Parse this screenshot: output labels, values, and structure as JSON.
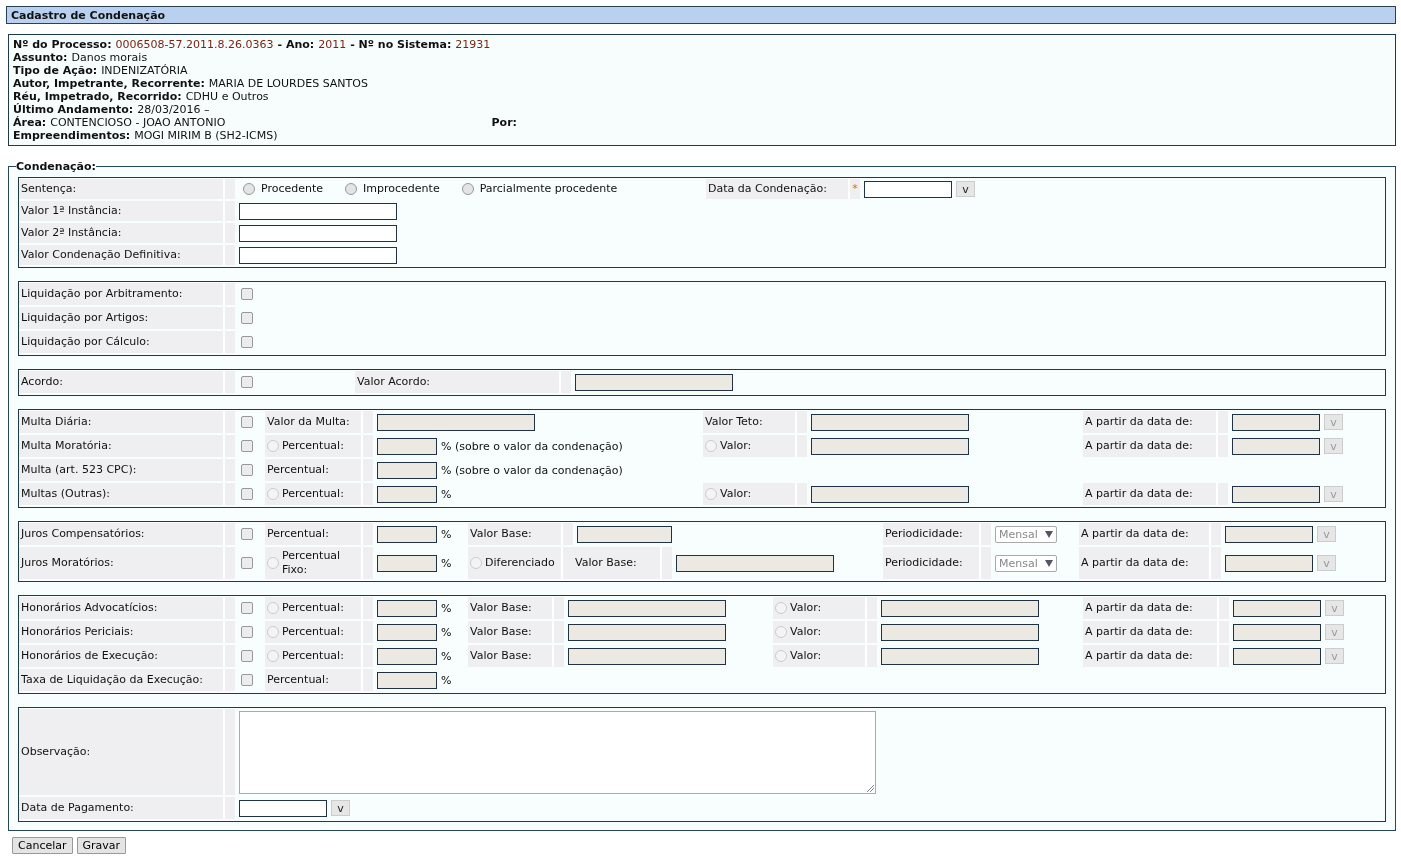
{
  "title": "Cadastro de Condenação",
  "info": {
    "lines": [
      [
        {
          "label": "Nº do Processo:",
          "value": "0006508-57.2011.8.26.0363",
          "kind": "ref"
        },
        {
          "label": "- Ano:",
          "value": "2011",
          "kind": "ref"
        },
        {
          "label": "- Nº no Sistema:",
          "value": "21931",
          "kind": "ref"
        }
      ],
      [
        {
          "label": "Assunto:",
          "value": "Danos morais",
          "kind": "plain"
        }
      ],
      [
        {
          "label": "Tipo de Ação:",
          "value": "INDENIZATÓRIA",
          "kind": "plain"
        }
      ],
      [
        {
          "label": "Autor, Impetrante, Recorrente:",
          "value": "MARIA DE LOURDES SANTOS",
          "kind": "plain"
        }
      ],
      [
        {
          "label": "Réu, Impetrado, Recorrido:",
          "value": "CDHU e Outros",
          "kind": "plain"
        }
      ],
      [
        {
          "label": "Último Andamento:",
          "value": "28/03/2016 –",
          "kind": "plain"
        }
      ],
      [
        {
          "label": "Área:",
          "value": "CONTENCIOSO - JOAO ANTONIO",
          "kind": "plain"
        },
        {
          "label": "Por:",
          "kind": "column"
        }
      ],
      [
        {
          "label": "Empreendimentos:",
          "value": "MOGI MIRIM B (SH2-ICMS)",
          "kind": "plain"
        }
      ]
    ]
  },
  "legend": "Condenação:",
  "sections": [
    {
      "rows": [
        {
          "cells": [
            {
              "kind": "label",
              "text": "Sentença:"
            },
            {
              "kind": "radios",
              "options": [
                {
                  "label": "Procedente",
                  "selected": false
                },
                {
                  "label": "Improcedente",
                  "selected": false
                },
                {
                  "label": "Parcialmente procedente",
                  "selected": false
                }
              ]
            },
            {
              "kind": "label",
              "text": "Data da Condenação:",
              "required_mark": "*"
            },
            {
              "kind": "date",
              "disabled": false,
              "button": "v"
            }
          ]
        },
        {
          "cells": [
            {
              "kind": "label",
              "text": "Valor 1ª Instância:"
            },
            {
              "kind": "field",
              "disabled": false
            }
          ]
        },
        {
          "cells": [
            {
              "kind": "label",
              "text": "Valor 2ª Instância:"
            },
            {
              "kind": "field",
              "disabled": false
            }
          ]
        },
        {
          "cells": [
            {
              "kind": "label",
              "text": "Valor Condenação Definitiva:"
            },
            {
              "kind": "field",
              "disabled": false
            }
          ]
        }
      ]
    },
    {
      "rows": [
        {
          "cells": [
            {
              "kind": "label",
              "text": "Liquidação por Arbitramento:"
            },
            {
              "kind": "check",
              "checked": false
            }
          ]
        },
        {
          "cells": [
            {
              "kind": "label",
              "text": "Liquidação por Artigos:"
            },
            {
              "kind": "check",
              "checked": false
            }
          ]
        },
        {
          "cells": [
            {
              "kind": "label",
              "text": "Liquidação por Cálculo:"
            },
            {
              "kind": "check",
              "checked": false
            }
          ]
        }
      ]
    },
    {
      "rows": [
        {
          "cells": [
            {
              "kind": "label",
              "text": "Acordo:"
            },
            {
              "kind": "check",
              "checked": false
            },
            {
              "kind": "label",
              "text": "Valor Acordo:"
            },
            {
              "kind": "field",
              "disabled": true
            }
          ]
        }
      ]
    },
    {
      "rows": [
        {
          "cells": [
            {
              "kind": "label",
              "text": "Multa Diária:"
            },
            {
              "kind": "check",
              "checked": false
            },
            {
              "kind": "label",
              "text": "Valor da Multa:"
            },
            {
              "kind": "field",
              "disabled": true
            },
            {
              "kind": "label",
              "text": "Valor Teto:"
            },
            {
              "kind": "field",
              "disabled": true
            },
            {
              "kind": "label",
              "text": "A partir da data de:"
            },
            {
              "kind": "date",
              "disabled": true,
              "button": "v"
            }
          ]
        },
        {
          "cells": [
            {
              "kind": "label",
              "text": "Multa Moratória:"
            },
            {
              "kind": "check",
              "checked": false
            },
            {
              "kind": "label",
              "text": "Percentual:",
              "radio": {
                "selected": false
              }
            },
            {
              "kind": "short-field",
              "disabled": true,
              "suffix": "% (sobre o valor da condenação)"
            },
            {
              "kind": "label",
              "text": "Valor:",
              "radio": {
                "selected": false
              }
            },
            {
              "kind": "field",
              "disabled": true
            },
            {
              "kind": "label",
              "text": "A partir da data de:"
            },
            {
              "kind": "date",
              "disabled": true,
              "button": "v"
            }
          ]
        },
        {
          "cells": [
            {
              "kind": "label",
              "text": "Multa (art. 523 CPC):"
            },
            {
              "kind": "check",
              "checked": false
            },
            {
              "kind": "label",
              "text": "Percentual:"
            },
            {
              "kind": "short-field",
              "disabled": true,
              "suffix": "% (sobre o valor da condenação)"
            }
          ]
        },
        {
          "cells": [
            {
              "kind": "label",
              "text": "Multas (Outras):"
            },
            {
              "kind": "check",
              "checked": false
            },
            {
              "kind": "label",
              "text": "Percentual:",
              "radio": {
                "selected": false
              }
            },
            {
              "kind": "short-field",
              "disabled": true,
              "suffix": "%"
            },
            {
              "kind": "label",
              "text": "Valor:",
              "radio": {
                "selected": false
              }
            },
            {
              "kind": "field",
              "disabled": true
            },
            {
              "kind": "label",
              "text": "A partir da data de:"
            },
            {
              "kind": "date",
              "disabled": true,
              "button": "v"
            }
          ]
        }
      ]
    },
    {
      "rows": [
        {
          "cells": [
            {
              "kind": "label",
              "text": "Juros Compensatórios:"
            },
            {
              "kind": "check",
              "checked": false
            },
            {
              "kind": "label",
              "text": "Percentual:"
            },
            {
              "kind": "short-field",
              "disabled": true,
              "suffix": "%"
            },
            {
              "kind": "label",
              "text": "Valor Base:"
            },
            {
              "kind": "field",
              "disabled": true
            },
            "",
            {
              "kind": "label",
              "text": "Periodicidade:"
            },
            {
              "kind": "select",
              "disabled": true,
              "value": "Mensal"
            },
            {
              "kind": "label",
              "text": "A partir da data de:"
            },
            {
              "kind": "date",
              "disabled": true,
              "button": "v"
            }
          ]
        },
        {
          "cells": [
            {
              "kind": "label",
              "text": "Juros Moratórios:"
            },
            {
              "kind": "check",
              "checked": false
            },
            {
              "kind": "label",
              "text": "Percentual Fixo:",
              "radio": {
                "selected": false
              }
            },
            {
              "kind": "short-field",
              "disabled": true,
              "suffix": "%"
            },
            {
              "kind": "label",
              "text": "Diferenciado",
              "radio": {
                "selected": false
              }
            },
            {
              "kind": "label",
              "text": "Valor Base:"
            },
            {
              "kind": "field",
              "disabled": true
            },
            {
              "kind": "label",
              "text": "Periodicidade:"
            },
            {
              "kind": "select",
              "disabled": true,
              "value": "Mensal"
            },
            {
              "kind": "label",
              "text": "A partir da data de:"
            },
            {
              "kind": "date",
              "disabled": true,
              "button": "v"
            }
          ]
        }
      ]
    },
    {
      "rows": [
        {
          "cells": [
            {
              "kind": "label",
              "text": "Honorários Advocatícios:"
            },
            {
              "kind": "check",
              "checked": false
            },
            {
              "kind": "label",
              "text": "Percentual:",
              "radio": {
                "selected": false
              }
            },
            {
              "kind": "short-field",
              "disabled": true,
              "suffix": "%"
            },
            {
              "kind": "label",
              "text": "Valor Base:"
            },
            {
              "kind": "field",
              "disabled": true
            },
            {
              "kind": "label",
              "text": "Valor:",
              "radio": {
                "selected": false
              }
            },
            {
              "kind": "field",
              "disabled": true
            },
            {
              "kind": "label",
              "text": "A partir da data de:"
            },
            {
              "kind": "date",
              "disabled": true,
              "button": "v"
            }
          ]
        },
        {
          "cells": [
            {
              "kind": "label",
              "text": "Honorários Periciais:"
            },
            {
              "kind": "check",
              "checked": false
            },
            {
              "kind": "label",
              "text": "Percentual:",
              "radio": {
                "selected": false
              }
            },
            {
              "kind": "short-field",
              "disabled": true,
              "suffix": "%"
            },
            {
              "kind": "label",
              "text": "Valor Base:"
            },
            {
              "kind": "field",
              "disabled": true
            },
            {
              "kind": "label",
              "text": "Valor:",
              "radio": {
                "selected": false
              }
            },
            {
              "kind": "field",
              "disabled": true
            },
            {
              "kind": "label",
              "text": "A partir da data de:"
            },
            {
              "kind": "date",
              "disabled": true,
              "button": "v"
            }
          ]
        },
        {
          "cells": [
            {
              "kind": "label",
              "text": "Honorários de Execução:"
            },
            {
              "kind": "check",
              "checked": false
            },
            {
              "kind": "label",
              "text": "Percentual:",
              "radio": {
                "selected": false
              }
            },
            {
              "kind": "short-field",
              "disabled": true,
              "suffix": "%"
            },
            {
              "kind": "label",
              "text": "Valor Base:"
            },
            {
              "kind": "field",
              "disabled": true
            },
            {
              "kind": "label",
              "text": "Valor:",
              "radio": {
                "selected": false
              }
            },
            {
              "kind": "field",
              "disabled": true
            },
            {
              "kind": "label",
              "text": "A partir da data de:"
            },
            {
              "kind": "date",
              "disabled": true,
              "button": "v"
            }
          ]
        },
        {
          "cells": [
            {
              "kind": "label",
              "text": "Taxa de Liquidação da Execução:"
            },
            {
              "kind": "check",
              "checked": false
            },
            {
              "kind": "label",
              "text": "Percentual:"
            },
            {
              "kind": "short-field",
              "disabled": true,
              "suffix": "%"
            }
          ]
        }
      ]
    },
    {
      "rows": [
        {
          "cells": [
            {
              "kind": "label",
              "text": "Observação:"
            },
            {
              "kind": "textarea",
              "disabled": false
            }
          ]
        },
        {
          "cells": [
            {
              "kind": "label",
              "text": "Data de Pagamento:"
            },
            {
              "kind": "date",
              "disabled": false,
              "button": "v"
            }
          ]
        }
      ]
    }
  ],
  "buttons": [
    {
      "label": "Cancelar"
    },
    {
      "label": "Gravar"
    }
  ]
}
